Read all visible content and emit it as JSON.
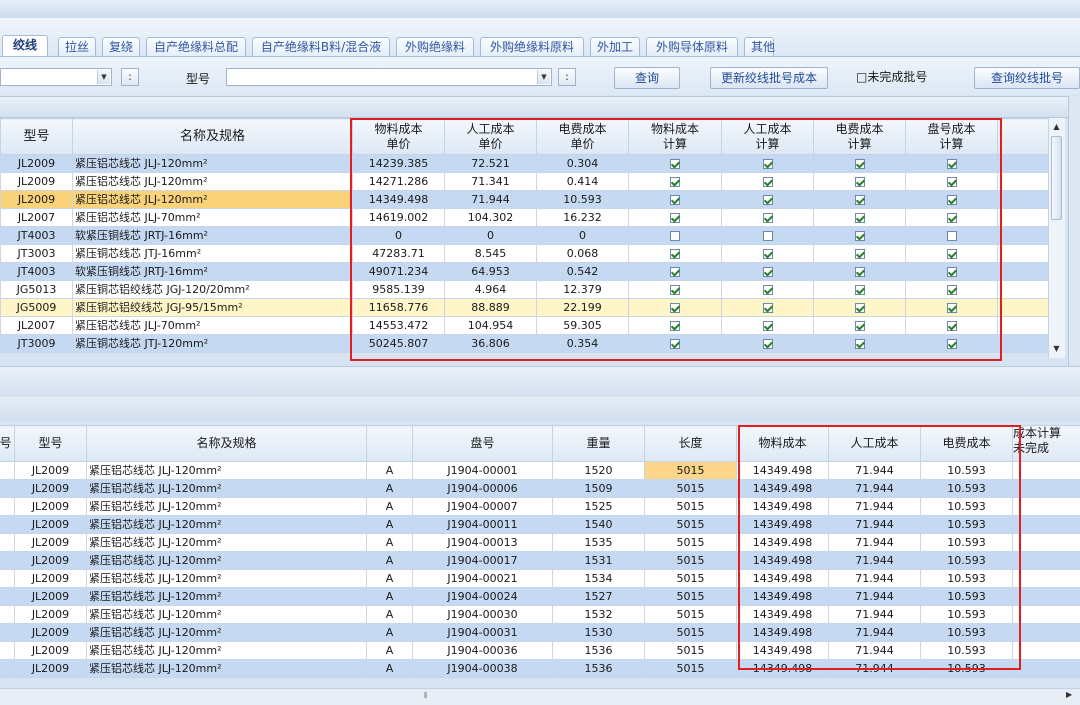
{
  "tabs": [
    {
      "label": "绞线",
      "active": true
    },
    {
      "label": "拉丝"
    },
    {
      "label": "复绕"
    },
    {
      "label": "自产绝缘料总配"
    },
    {
      "label": "自产绝缘料B料/混合液"
    },
    {
      "label": "外购绝缘料"
    },
    {
      "label": "外购绝缘料原料"
    },
    {
      "label": "外加工"
    },
    {
      "label": "外购导体原料"
    },
    {
      "label": "其他"
    }
  ],
  "filter": {
    "combo_small_btn": ":",
    "model_label": "型号",
    "model_value": "",
    "model_small_btn": ":",
    "query_button": "查询",
    "update_button": "更新绞线批号成本",
    "unfinished_checkbox": "□未完成批号",
    "query_batch_button": "查询绞线批号"
  },
  "top_grid": {
    "headers": [
      "型号",
      "名称及规格",
      "物料成本\n单价",
      "人工成本\n单价",
      "电费成本\n单价",
      "物料成本\n计算",
      "人工成本\n计算",
      "电费成本\n计算",
      "盘号成本\n计算"
    ],
    "rows": [
      {
        "model": "JL2009",
        "name": "紧压铝芯线芯 JLJ-120mm²",
        "mat": "14239.385",
        "lab": "72.521",
        "elec": "0.304",
        "c": [
          1,
          1,
          1,
          1
        ]
      },
      {
        "model": "JL2009",
        "name": "紧压铝芯线芯 JLJ-120mm²",
        "mat": "14271.286",
        "lab": "71.341",
        "elec": "0.414",
        "c": [
          1,
          1,
          1,
          1
        ]
      },
      {
        "model": "JL2009",
        "name": "紧压铝芯线芯 JLJ-120mm²",
        "mat": "14349.498",
        "lab": "71.944",
        "elec": "10.593",
        "c": [
          1,
          1,
          1,
          1
        ],
        "highlight": true
      },
      {
        "model": "JL2007",
        "name": "紧压铝芯线芯 JLJ-70mm²",
        "mat": "14619.002",
        "lab": "104.302",
        "elec": "16.232",
        "c": [
          1,
          1,
          1,
          1
        ]
      },
      {
        "model": "JT4003",
        "name": "软紧压铜线芯 JRTJ-16mm²",
        "mat": "0",
        "lab": "0",
        "elec": "0",
        "c": [
          0,
          0,
          1,
          0
        ]
      },
      {
        "model": "JT3003",
        "name": "紧压铜芯线芯 JTJ-16mm²",
        "mat": "47283.71",
        "lab": "8.545",
        "elec": "0.068",
        "c": [
          1,
          1,
          1,
          1
        ]
      },
      {
        "model": "JT4003",
        "name": "软紧压铜线芯 JRTJ-16mm²",
        "mat": "49071.234",
        "lab": "64.953",
        "elec": "0.542",
        "c": [
          1,
          1,
          1,
          1
        ]
      },
      {
        "model": "JG5013",
        "name": "紧压铜芯铝绞线芯 JGJ-120/20mm²",
        "mat": "9585.139",
        "lab": "4.964",
        "elec": "12.379",
        "c": [
          1,
          1,
          1,
          1
        ]
      },
      {
        "model": "JG5009",
        "name": "紧压铜芯铝绞线芯 JGJ-95/15mm²",
        "mat": "11658.776",
        "lab": "88.889",
        "elec": "22.199",
        "c": [
          1,
          1,
          1,
          1
        ],
        "sel": true
      },
      {
        "model": "JL2007",
        "name": "紧压铝芯线芯 JLJ-70mm²",
        "mat": "14553.472",
        "lab": "104.954",
        "elec": "59.305",
        "c": [
          1,
          1,
          1,
          1
        ]
      },
      {
        "model": "JT3009",
        "name": "紧压铜芯线芯 JTJ-120mm²",
        "mat": "50245.807",
        "lab": "36.806",
        "elec": "0.354",
        "c": [
          1,
          1,
          1,
          1
        ]
      }
    ]
  },
  "bottom_grid": {
    "headers": [
      "号",
      "型号",
      "名称及规格",
      "",
      "盘号",
      "重量",
      "长度",
      "物料成本",
      "人工成本",
      "电费成本",
      "成本计算\n未完成"
    ],
    "rows": [
      {
        "model": "JL2009",
        "name": "紧压铝芯线芯 JLJ-120mm²",
        "grade": "A",
        "reel": "J1904-00001",
        "weight": "1520",
        "length": "5015",
        "mat": "14349.498",
        "lab": "71.944",
        "elec": "10.593"
      },
      {
        "model": "JL2009",
        "name": "紧压铝芯线芯 JLJ-120mm²",
        "grade": "A",
        "reel": "J1904-00006",
        "weight": "1509",
        "length": "5015",
        "mat": "14349.498",
        "lab": "71.944",
        "elec": "10.593"
      },
      {
        "model": "JL2009",
        "name": "紧压铝芯线芯 JLJ-120mm²",
        "grade": "A",
        "reel": "J1904-00007",
        "weight": "1525",
        "length": "5015",
        "mat": "14349.498",
        "lab": "71.944",
        "elec": "10.593"
      },
      {
        "model": "JL2009",
        "name": "紧压铝芯线芯 JLJ-120mm²",
        "grade": "A",
        "reel": "J1904-00011",
        "weight": "1540",
        "length": "5015",
        "mat": "14349.498",
        "lab": "71.944",
        "elec": "10.593"
      },
      {
        "model": "JL2009",
        "name": "紧压铝芯线芯 JLJ-120mm²",
        "grade": "A",
        "reel": "J1904-00013",
        "weight": "1535",
        "length": "5015",
        "mat": "14349.498",
        "lab": "71.944",
        "elec": "10.593"
      },
      {
        "model": "JL2009",
        "name": "紧压铝芯线芯 JLJ-120mm²",
        "grade": "A",
        "reel": "J1904-00017",
        "weight": "1531",
        "length": "5015",
        "mat": "14349.498",
        "lab": "71.944",
        "elec": "10.593"
      },
      {
        "model": "JL2009",
        "name": "紧压铝芯线芯 JLJ-120mm²",
        "grade": "A",
        "reel": "J1904-00021",
        "weight": "1534",
        "length": "5015",
        "mat": "14349.498",
        "lab": "71.944",
        "elec": "10.593"
      },
      {
        "model": "JL2009",
        "name": "紧压铝芯线芯 JLJ-120mm²",
        "grade": "A",
        "reel": "J1904-00024",
        "weight": "1527",
        "length": "5015",
        "mat": "14349.498",
        "lab": "71.944",
        "elec": "10.593"
      },
      {
        "model": "JL2009",
        "name": "紧压铝芯线芯 JLJ-120mm²",
        "grade": "A",
        "reel": "J1904-00030",
        "weight": "1532",
        "length": "5015",
        "mat": "14349.498",
        "lab": "71.944",
        "elec": "10.593"
      },
      {
        "model": "JL2009",
        "name": "紧压铝芯线芯 JLJ-120mm²",
        "grade": "A",
        "reel": "J1904-00031",
        "weight": "1530",
        "length": "5015",
        "mat": "14349.498",
        "lab": "71.944",
        "elec": "10.593"
      },
      {
        "model": "JL2009",
        "name": "紧压铝芯线芯 JLJ-120mm²",
        "grade": "A",
        "reel": "J1904-00036",
        "weight": "1536",
        "length": "5015",
        "mat": "14349.498",
        "lab": "71.944",
        "elec": "10.593"
      },
      {
        "model": "JL2009",
        "name": "紧压铝芯线芯 JLJ-120mm²",
        "grade": "A",
        "reel": "J1904-00038",
        "weight": "1536",
        "length": "5015",
        "mat": "14349.498",
        "lab": "71.944",
        "elec": "10.593"
      }
    ]
  },
  "colors": {
    "highlight_red": "#e02020",
    "row_blue": "#c5daf2",
    "row_selected": "#fff6c8",
    "cell_orange": "#f9d27a"
  }
}
